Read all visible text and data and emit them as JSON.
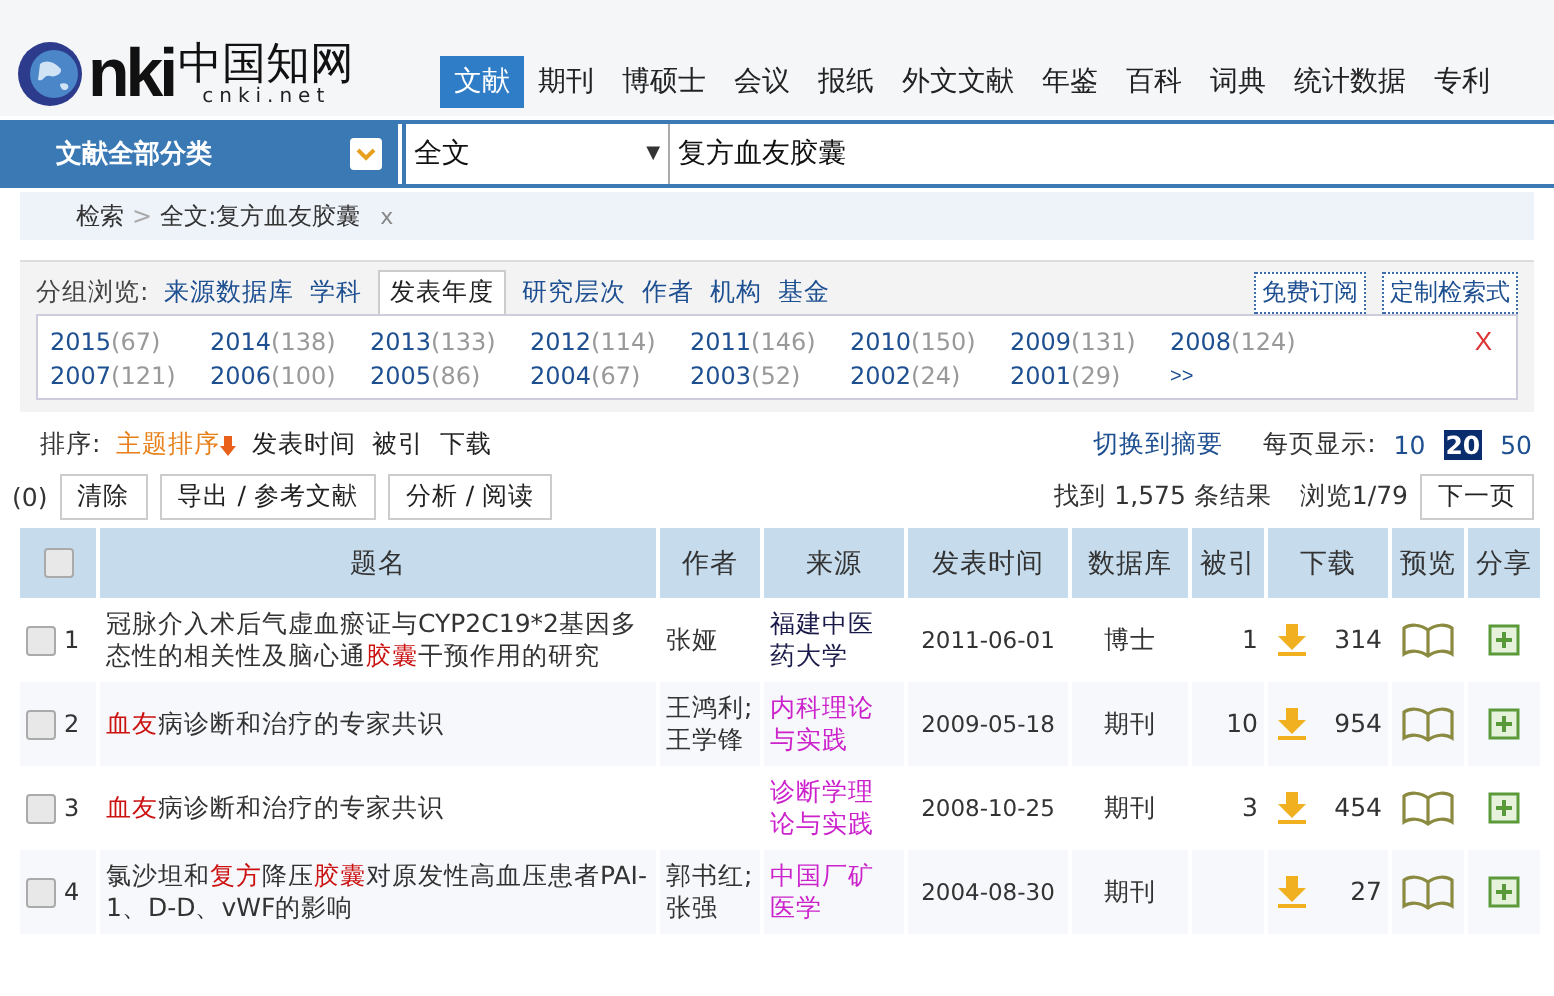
{
  "logo": {
    "brand": "nki",
    "chinese": "中国知网",
    "domain": "cnki.net"
  },
  "nav": [
    {
      "label": "文献",
      "selected": true
    },
    {
      "label": "期刊",
      "selected": false
    },
    {
      "label": "博硕士",
      "selected": false
    },
    {
      "label": "会议",
      "selected": false
    },
    {
      "label": "报纸",
      "selected": false
    },
    {
      "label": "外文文献",
      "selected": false
    },
    {
      "label": "年鉴",
      "selected": false
    },
    {
      "label": "百科",
      "selected": false
    },
    {
      "label": "词典",
      "selected": false
    },
    {
      "label": "统计数据",
      "selected": false
    },
    {
      "label": "专利",
      "selected": false
    }
  ],
  "search": {
    "category": "文献全部分类",
    "field": "全文",
    "field_caret": "▼",
    "value": "复方血友胶囊"
  },
  "breadcrumb": {
    "root": "检索",
    "sep": ">",
    "current": "全文:复方血友胶囊",
    "close": "x"
  },
  "group_browse": {
    "label": "分组浏览:",
    "tabs": [
      {
        "label": "来源数据库",
        "selected": false
      },
      {
        "label": "学科",
        "selected": false
      },
      {
        "label": "发表年度",
        "selected": true
      },
      {
        "label": "研究层次",
        "selected": false
      },
      {
        "label": "作者",
        "selected": false
      },
      {
        "label": "机构",
        "selected": false
      },
      {
        "label": "基金",
        "selected": false
      }
    ],
    "buttons": [
      "免费订阅",
      "定制检索式"
    ],
    "years": [
      {
        "year": "2015",
        "count": "(67)"
      },
      {
        "year": "2014",
        "count": "(138)"
      },
      {
        "year": "2013",
        "count": "(133)"
      },
      {
        "year": "2012",
        "count": "(114)"
      },
      {
        "year": "2011",
        "count": "(146)"
      },
      {
        "year": "2010",
        "count": "(150)"
      },
      {
        "year": "2009",
        "count": "(131)"
      },
      {
        "year": "2008",
        "count": "(124)"
      },
      {
        "year": "2007",
        "count": "(121)"
      },
      {
        "year": "2006",
        "count": "(100)"
      },
      {
        "year": "2005",
        "count": "(86)"
      },
      {
        "year": "2004",
        "count": "(67)"
      },
      {
        "year": "2003",
        "count": "(52)"
      },
      {
        "year": "2002",
        "count": "(24)"
      },
      {
        "year": "2001",
        "count": "(29)"
      }
    ],
    "more": ">>",
    "close": "X"
  },
  "sort": {
    "label": "排序:",
    "options": [
      {
        "label": "主题排序",
        "selected": true
      },
      {
        "label": "发表时间",
        "selected": false
      },
      {
        "label": "被引",
        "selected": false
      },
      {
        "label": "下载",
        "selected": false
      }
    ],
    "switch": "切换到摘要",
    "per_page_label": "每页显示:",
    "per_page": [
      {
        "label": "10",
        "selected": false
      },
      {
        "label": "20",
        "selected": true
      },
      {
        "label": "50",
        "selected": false
      }
    ]
  },
  "actions": {
    "count": "(0)",
    "buttons": [
      "清除",
      "导出 / 参考文献",
      "分析 / 阅读"
    ],
    "found": "找到 1,575 条结果",
    "page": "浏览1/79",
    "next": "下一页"
  },
  "table": {
    "select_all_checked": false,
    "columns": [
      "题名",
      "作者",
      "来源",
      "发表时间",
      "数据库",
      "被引",
      "下载",
      "预览",
      "分享"
    ],
    "rows": [
      {
        "checked": false,
        "number": "1",
        "title": [
          {
            "text": "冠脉介入术后气虚血瘀证与CYP2C19*2基因多态性的相关性及脑心通",
            "highlight": false
          },
          {
            "text": "胶囊",
            "highlight": true
          },
          {
            "text": "干预作用的研究",
            "highlight": false
          }
        ],
        "author": "张娅",
        "source": {
          "text": "福建中医药大学",
          "color": "#1a1a4a"
        },
        "date": "2011-06-01",
        "database": "博士",
        "cited": "1",
        "downloads": "314"
      },
      {
        "checked": false,
        "number": "2",
        "title": [
          {
            "text": "血友",
            "highlight": true
          },
          {
            "text": "病诊断和治疗的专家共识",
            "highlight": false
          }
        ],
        "author": "王鸿利;王学锋",
        "source": {
          "text": "内科理论与实践",
          "color": "#cc22cc"
        },
        "date": "2009-05-18",
        "database": "期刊",
        "cited": "10",
        "downloads": "954"
      },
      {
        "checked": false,
        "number": "3",
        "title": [
          {
            "text": "血友",
            "highlight": true
          },
          {
            "text": "病诊断和治疗的专家共识",
            "highlight": false
          }
        ],
        "source": {
          "text": "诊断学理论与实践",
          "color": "#cc22cc"
        },
        "date": "2008-10-25",
        "database": "期刊",
        "cited": "3",
        "downloads": "454"
      },
      {
        "checked": false,
        "number": "4",
        "title": [
          {
            "text": "氯沙坦和",
            "highlight": false
          },
          {
            "text": "复方",
            "highlight": true
          },
          {
            "text": "降压",
            "highlight": false
          },
          {
            "text": "胶囊",
            "highlight": true
          },
          {
            "text": "对原发性高血压患者PAI-1、D-D、vWF的影响",
            "highlight": false
          }
        ],
        "author": "郭书红;张强",
        "source": {
          "text": "中国厂矿医学",
          "color": "#cc22cc"
        },
        "date": "2004-08-30",
        "database": "期刊",
        "downloads": "27"
      }
    ]
  }
}
